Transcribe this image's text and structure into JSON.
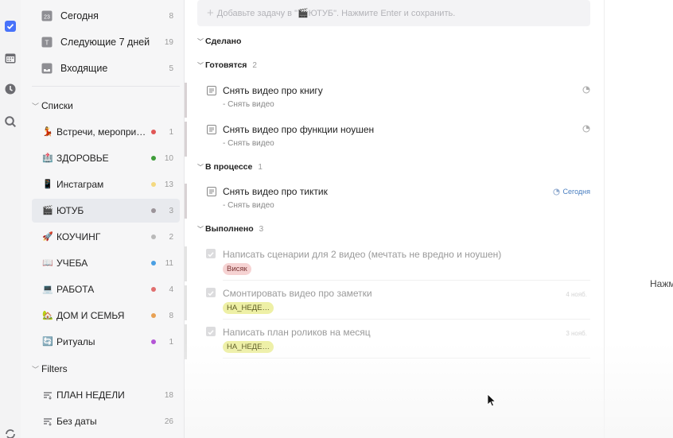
{
  "add_task": {
    "placeholder": "Добавьте задачу в \"🎬ЮТУБ\". Нажмите Enter и сохранить."
  },
  "smart_lists": [
    {
      "label": "Сегодня",
      "count": "8"
    },
    {
      "label": "Следующие 7 дней",
      "count": "19"
    },
    {
      "label": "Входящие",
      "count": "5"
    }
  ],
  "lists_header": "Списки",
  "lists": [
    {
      "emoji": "💃",
      "label": "Встречи, мероприят…",
      "color": "#e05656",
      "count": "1"
    },
    {
      "emoji": "🏥",
      "label": "ЗДОРОВЬЕ",
      "color": "#3f9d3a",
      "count": "10"
    },
    {
      "emoji": "📱",
      "label": "Инстаграм",
      "color": "#f4d980",
      "count": "13"
    },
    {
      "emoji": "🎬",
      "label": "ЮТУБ",
      "color": "#9b9499",
      "count": "3"
    },
    {
      "emoji": "🚀",
      "label": "КОУЧИНГ",
      "color": "#b9b9b9",
      "count": "2"
    },
    {
      "emoji": "📖",
      "label": "УЧЕБА",
      "color": "#4a9fe3",
      "count": "11"
    },
    {
      "emoji": "💻",
      "label": "РАБОТА",
      "color": "#e06e6e",
      "count": "4"
    },
    {
      "emoji": "🏡",
      "label": "ДОМ И СЕМЬЯ",
      "color": "#e8a154",
      "count": "8"
    },
    {
      "emoji": "🔄",
      "label": "Ритуалы",
      "color": "#b455d6",
      "count": "1"
    }
  ],
  "filters_header": "Filters",
  "filters": [
    {
      "label": "ПЛАН НЕДЕЛИ",
      "count": "18"
    },
    {
      "label": "Без даты",
      "count": "26"
    }
  ],
  "sections": {
    "done_header": "Сделано",
    "preparing": {
      "label": "Готовятся",
      "count": "2"
    },
    "in_progress": {
      "label": "В процессе",
      "count": "1"
    },
    "completed": {
      "label": "Выполнено",
      "count": "3"
    }
  },
  "tasks_preparing": [
    {
      "title": "Снять видео про книгу",
      "subtitle": "- Снять видео"
    },
    {
      "title": "Снять видео про функции ноушен",
      "subtitle": "- Снять видео"
    }
  ],
  "tasks_in_progress": [
    {
      "title": "Снять видео про тиктик",
      "subtitle": "- Снять видео",
      "due": "Сегодня"
    }
  ],
  "tasks_completed": [
    {
      "title": "Написать сценарии для 2 видео (мечтать не вредно и ноушен)",
      "tag": "Висяк",
      "tag_bg": "#f6d3d3",
      "tag_fg": "#7a3434"
    },
    {
      "title": "Смонтировать видео про заметки",
      "tag": "НА_НЕДЕ…",
      "tag_bg": "#eef0a6",
      "tag_fg": "#5b5a22",
      "date": "4 нояб."
    },
    {
      "title": "Написать план роликов на месяц",
      "tag": "НА_НЕДЕ…",
      "tag_bg": "#eef0a6",
      "tag_fg": "#5b5a22",
      "date": "3 нояб."
    }
  ],
  "right_hint": "Нажм"
}
